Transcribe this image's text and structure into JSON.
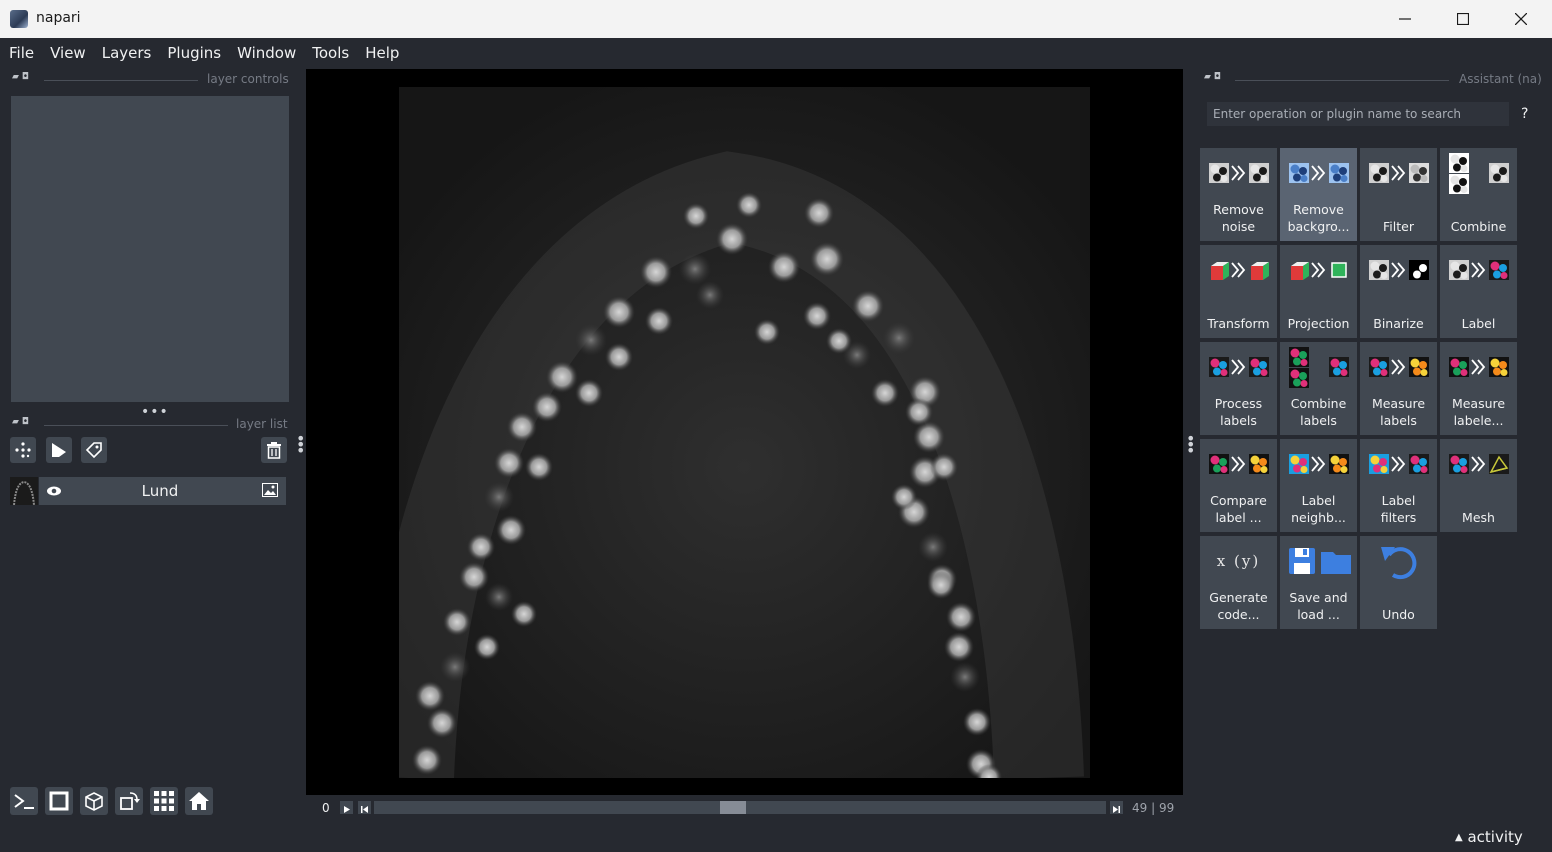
{
  "window": {
    "title": "napari"
  },
  "menu": [
    "File",
    "View",
    "Layers",
    "Plugins",
    "Window",
    "Tools",
    "Help"
  ],
  "left_dock": {
    "layer_controls_label": "layer controls",
    "layer_list_label": "layer list",
    "layer_name": "Lund",
    "layer_type_icon": "image-icon",
    "tools": [
      "points-layer-icon",
      "shapes-layer-icon",
      "labels-layer-icon",
      "delete-layer-icon"
    ],
    "bottom_buttons": [
      "console-icon",
      "2d-3d-toggle-icon",
      "roll-axes-icon",
      "transpose-icon",
      "grid-icon",
      "home-icon"
    ]
  },
  "viewer": {
    "slider": {
      "current": "0",
      "value": "49",
      "max": "99",
      "fraction": 0.49
    }
  },
  "assistant": {
    "title": "Assistant (na)",
    "search_placeholder": "Enter operation or plugin name to search",
    "help": "?",
    "tiles": [
      {
        "label": "Remove noise",
        "selected": false
      },
      {
        "label": "Remove backgro...",
        "selected": true
      },
      {
        "label": "Filter",
        "selected": false
      },
      {
        "label": "Combine",
        "selected": false
      },
      {
        "label": "Transform",
        "selected": false
      },
      {
        "label": "Projection",
        "selected": false
      },
      {
        "label": "Binarize",
        "selected": false
      },
      {
        "label": "Label",
        "selected": false
      },
      {
        "label": "Process labels",
        "selected": false
      },
      {
        "label": "Combine labels",
        "selected": false
      },
      {
        "label": "Measure labels",
        "selected": false
      },
      {
        "label": "Measure labele...",
        "selected": false
      },
      {
        "label": "Compare label ...",
        "selected": false
      },
      {
        "label": "Label neighb...",
        "selected": false
      },
      {
        "label": "Label filters",
        "selected": false
      },
      {
        "label": "Mesh",
        "selected": false
      },
      {
        "label": "Generate code...",
        "selected": false
      },
      {
        "label": "Save and load ...",
        "selected": false
      },
      {
        "label": "Undo",
        "selected": false
      }
    ],
    "generate_code_glyph": "x (y)"
  },
  "status": {
    "activity": "activity"
  },
  "colors": {
    "bg": "#262930",
    "panel": "#414851",
    "accent_blue": "#3d7fe0"
  }
}
